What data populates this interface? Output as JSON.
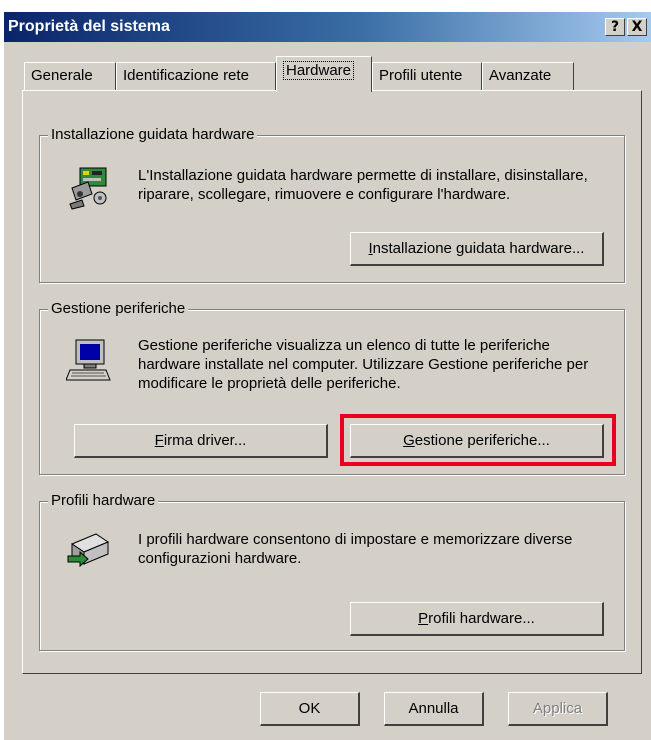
{
  "window": {
    "title": "Proprietà del sistema",
    "help_label": "?",
    "close_label": "X"
  },
  "tabs": [
    {
      "label": "Generale"
    },
    {
      "label": "Identificazione rete"
    },
    {
      "label": "Hardware"
    },
    {
      "label": "Profili utente"
    },
    {
      "label": "Avanzate"
    }
  ],
  "wizard": {
    "title": "Installazione guidata hardware",
    "description": "L'Installazione guidata hardware permette di installare, disinstallare, riparare, scollegare, rimuovere e configurare l'hardware.",
    "button_mnemonic": "I",
    "button_rest": "nstallazione guidata hardware...",
    "icon": "hardware-wizard-icon"
  },
  "device_manager": {
    "title": "Gestione periferiche",
    "description": "Gestione periferiche visualizza un elenco di tutte le periferiche hardware installate nel computer. Utilizzare Gestione periferiche per modificare le proprietà delle periferiche.",
    "driver_button_mnemonic": "F",
    "driver_button_rest": "irma driver...",
    "manager_button_mnemonic": "G",
    "manager_button_rest": "estione periferiche...",
    "icon": "computer-icon",
    "highlight_color": "#e8001c"
  },
  "profiles": {
    "title": "Profili hardware",
    "description": "I profili hardware consentono di impostare e memorizzare diverse configurazioni hardware.",
    "button_mnemonic": "P",
    "button_rest": "rofili hardware...",
    "icon": "hardware-profiles-icon"
  },
  "footer": {
    "ok_label": "OK",
    "cancel_label": "Annulla",
    "apply_label": "Applica"
  },
  "colors": {
    "dialog_face": "#d4d0c8",
    "title_start": "#0a246a",
    "title_end": "#a6caf0"
  }
}
